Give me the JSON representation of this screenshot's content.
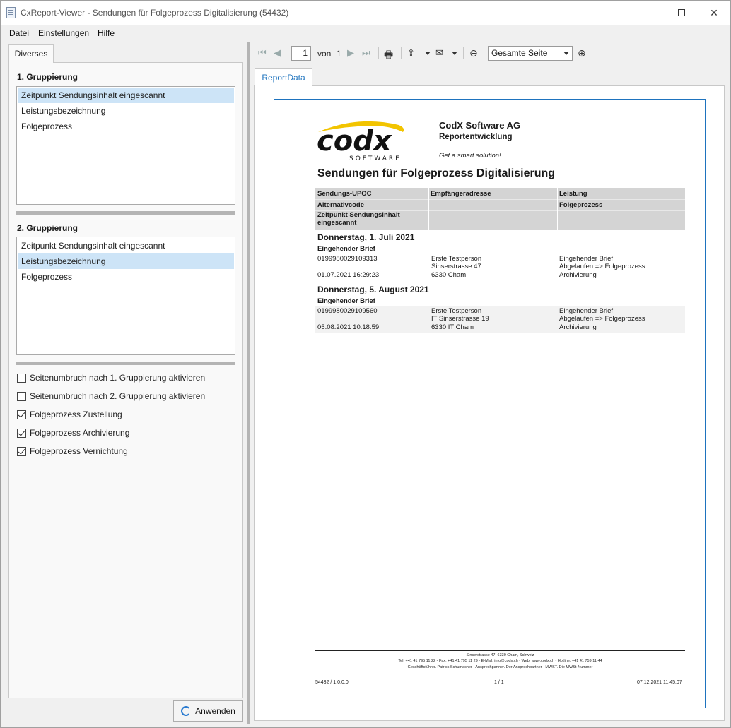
{
  "window": {
    "title": "CxReport-Viewer - Sendungen für Folgeprozess Digitalisierung (54432)"
  },
  "menu": {
    "datei": {
      "u": "D",
      "rest": "atei"
    },
    "einstellungen": {
      "u": "E",
      "rest": "instellungen"
    },
    "hilfe": {
      "u": "H",
      "rest": "ilfe"
    }
  },
  "left": {
    "tab_label": "Diverses",
    "group1": {
      "title": "1. Gruppierung",
      "items": [
        "Zeitpunkt Sendungsinhalt eingescannt",
        "Leistungsbezeichnung",
        "Folgeprozess"
      ],
      "selected_index": 0
    },
    "group2": {
      "title": "2. Gruppierung",
      "items": [
        "Zeitpunkt Sendungsinhalt eingescannt",
        "Leistungsbezeichnung",
        "Folgeprozess"
      ],
      "selected_index": 1
    },
    "options": [
      {
        "label": "Seitenumbruch nach 1. Gruppierung aktivieren",
        "checked": false
      },
      {
        "label": "Seitenumbruch nach 2. Gruppierung aktivieren",
        "checked": false
      },
      {
        "label": "Folgeprozess Zustellung",
        "checked": true
      },
      {
        "label": "Folgeprozess Archivierung",
        "checked": true
      },
      {
        "label": "Folgeprozess Vernichtung",
        "checked": true
      }
    ],
    "apply": {
      "u": "A",
      "rest": "nwenden"
    }
  },
  "toolbar": {
    "page_current": "1",
    "page_of": "von",
    "page_total": "1",
    "zoom_value": "Gesamte Seite",
    "icons": [
      "first-page-icon",
      "prev-page-icon",
      "next-page-icon",
      "last-page-icon",
      "print-icon",
      "export-icon",
      "mail-icon",
      "zoom-out-icon",
      "zoom-in-icon"
    ]
  },
  "report_tab": "ReportData",
  "report": {
    "logo": {
      "word": "codx",
      "sub": "SOFTWARE",
      "swoosh_color": "#f2c400"
    },
    "company": "CodX Software AG",
    "department": "Reportentwicklung",
    "slogan": "Get a smart solution!",
    "title": "Sendungen für Folgeprozess Digitalisierung",
    "headers": {
      "c1_r1": "Sendungs-UPOC",
      "c1_r2": "Alternativcode",
      "c1_r3a": "Zeitpunkt Sendungsinhalt",
      "c1_r3b": "eingescannt",
      "c2_r1": "Empfängeradresse",
      "c3_r1": "Leistung",
      "c3_r2": "Folgeprozess"
    },
    "groups": [
      {
        "day": "Donnerstag, 1. Juli 2021",
        "sub": "Eingehender Brief",
        "row": {
          "upoc": "0199980029109313",
          "time": "01.07.2021 16:29:23",
          "addr1": "Erste Testperson",
          "addr2": "Sinserstrasse 47",
          "addr3": "6330 Cham",
          "l1": "Eingehender Brief",
          "l2": "Abgelaufen => Folgeprozess",
          "l3": "Archivierung"
        }
      },
      {
        "day": "Donnerstag, 5. August 2021",
        "sub": "Eingehender Brief",
        "row": {
          "upoc": "0199980029109560",
          "time": "05.08.2021 10:18:59",
          "addr1": "Erste Testperson",
          "addr2": "IT Sinserstrasse 19",
          "addr3": "6330 IT Cham",
          "l1": "Eingehender Brief",
          "l2": "Abgelaufen => Folgeprozess",
          "l3": "Archivierung"
        }
      }
    ],
    "footer": {
      "line1": "Sinserstrasse 47, 6330 Cham, Schweiz",
      "line2": "Tel. +41 41 795 11 22 - Fax. +41 41 795 11 29 - E-Mail. info@codx.ch - Web. www.codx.ch - Hotline. +41 41 759 11 44",
      "line3": "Geschäftsführer. Patrick Schumacher - Ansprechpartner. Der Ansprechpartner - MWST. Die MWSt-Nummer",
      "left": "54432 / 1.0.0.0",
      "center": "1 / 1",
      "right": "07.12.2021 11:45:07"
    }
  }
}
